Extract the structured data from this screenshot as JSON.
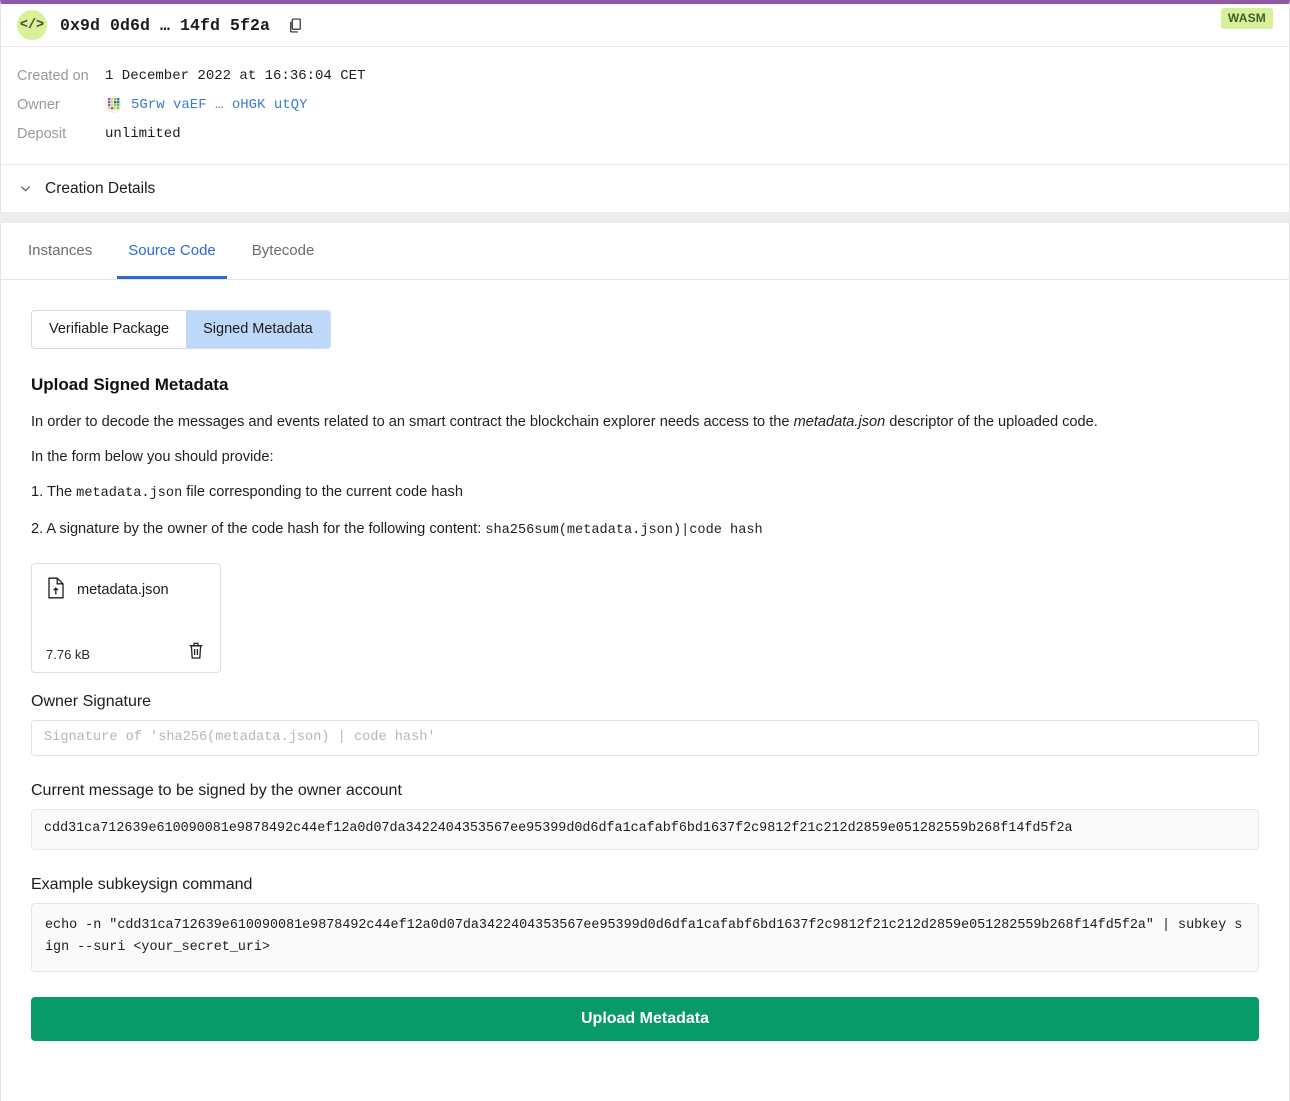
{
  "header": {
    "code_icon": "code-icon",
    "contract_hash": "0x9d 0d6d … 14fd 5f2a",
    "copy_icon": "copy-icon",
    "badge": "WASM"
  },
  "details": {
    "rows": [
      {
        "label": "Created on",
        "value": "1 December 2022 at 16:36:04 CET"
      },
      {
        "label": "Owner",
        "value": "5Grw vaEF … oHGK utQY"
      },
      {
        "label": "Deposit",
        "value": "unlimited"
      }
    ],
    "creation_details_label": "Creation Details",
    "chevron_icon": "chevron-down-icon"
  },
  "tabs": [
    {
      "label": "Instances",
      "active": false
    },
    {
      "label": "Source Code",
      "active": true
    },
    {
      "label": "Bytecode",
      "active": false
    }
  ],
  "segmented": {
    "options": [
      {
        "label": "Verifiable Package",
        "active": false
      },
      {
        "label": "Signed Metadata",
        "active": true
      }
    ]
  },
  "main": {
    "title": "Upload Signed Metadata",
    "intro_part1": "In order to decode the messages and events related to an smart contract the blockchain explorer needs access to the ",
    "intro_italic": "metadata.json",
    "intro_part2": " descriptor of the uploaded code.",
    "provide_label": "In the form below you should provide:",
    "item1_prefix": "1. The ",
    "item1_mono": "metadata.json",
    "item1_suffix": " file corresponding to the current code hash",
    "item2_prefix": "2. A signature by the owner of the code hash for the following content: ",
    "item2_mono": "sha256sum(metadata.json)|code hash"
  },
  "file": {
    "icon": "file-upload-icon",
    "name": "metadata.json",
    "size": "7.76 kB",
    "delete_icon": "trash-icon"
  },
  "form": {
    "signature_label": "Owner Signature",
    "signature_value": "",
    "signature_placeholder": "Signature of 'sha256(metadata.json) | code hash'",
    "message_label": "Current message to be signed by the owner account",
    "message_value": "cdd31ca712639e610090081e9878492c44ef12a0d07da3422404353567ee95399d0d6dfa1cafabf6bd1637f2c9812f21c212d2859e051282559b268f14fd5f2a",
    "command_label": "Example subkeysign command",
    "command_value": "echo -n \"cdd31ca712639e610090081e9878492c44ef12a0d07da3422404353567ee95399d0d6dfa1cafabf6bd1637f2c9812f21c212d2859e051282559b268f14fd5f2a\" | subkey sign --suri <your_secret_uri>",
    "submit_label": "Upload Metadata"
  },
  "colors": {
    "accent_purple": "#8d56a6",
    "badge_green_bg": "#d7f09a",
    "badge_green_text": "#3f6024",
    "tab_active_blue": "#2c6ad4",
    "segment_active_blue": "#bed8fa",
    "link_blue": "#3a7cd6",
    "submit_green": "#089a69"
  }
}
